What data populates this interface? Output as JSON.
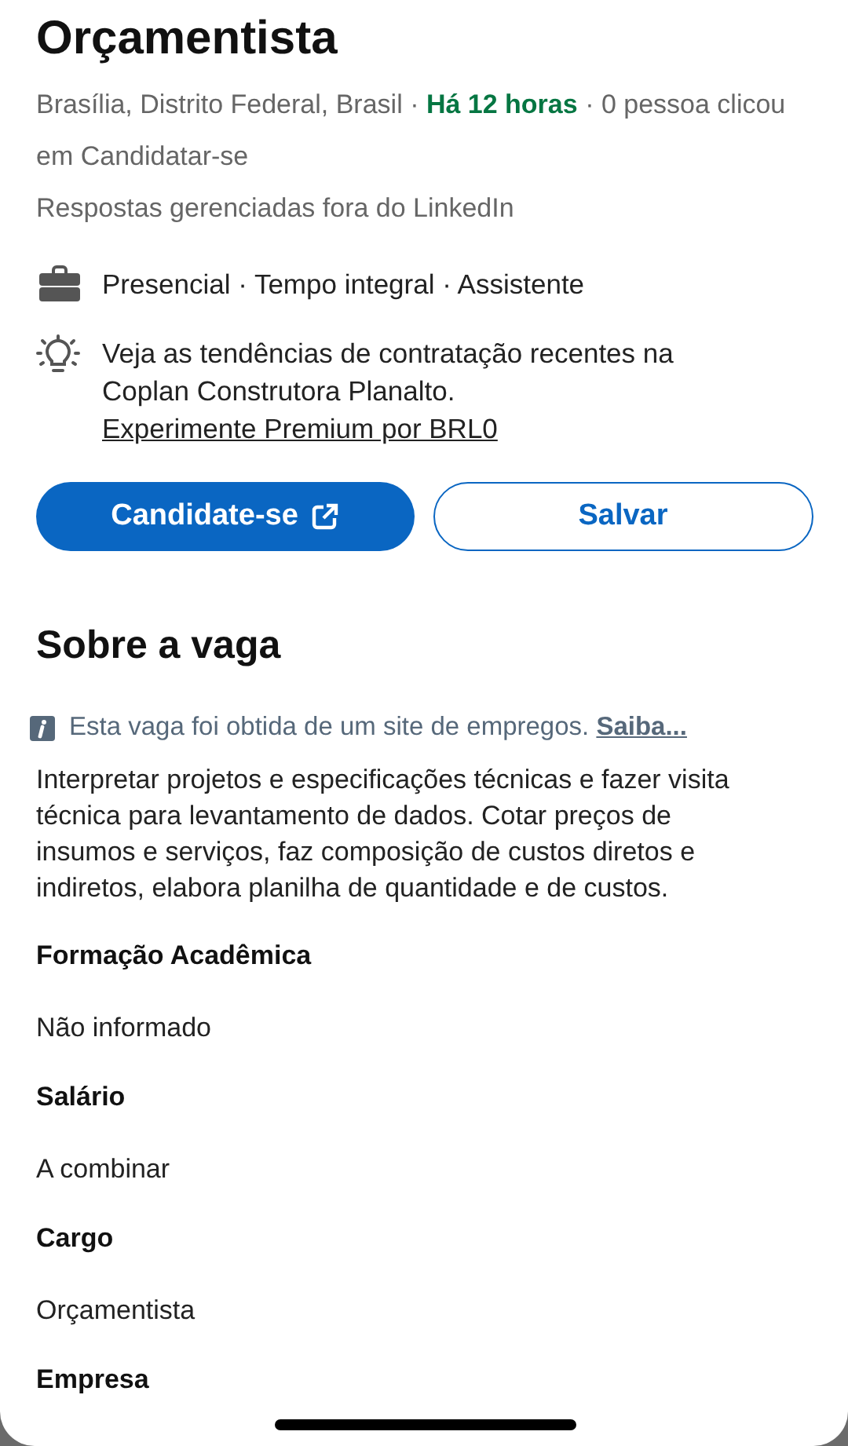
{
  "job": {
    "title": "Orçamentista",
    "meta": "Brasília, Distrito Federal, Brasil · **Há 12 horas** · 0 pessoa clicou em Candidatar-se",
    "responses": "Respostas gerenciadas fora do LinkedIn",
    "workplace": "Presencial · Tempo integral · Assistente",
    "insight": "Veja as tendências de contratação recentes na Coplan Construtora Planalto.",
    "insight_link": "Experimente Premium por BRL0"
  },
  "actions": [
    {
      "kind": "primary",
      "label": "Candidate-se",
      "external": true
    },
    {
      "kind": "secondary",
      "label": "Salvar",
      "external": false
    }
  ],
  "about": {
    "heading": "Sobre a vaga",
    "notice": "Esta vaga foi obtida de um site de empregos.",
    "notice_link": "Saiba...",
    "description": "Interpretar projetos e especificações técnicas e fazer visita técnica para levantamento de dados. Cotar preços de insumos e serviços, faz composição de custos diretos e indiretos, elabora planilha de quantidade e de custos.",
    "fields": [
      {
        "label": "Formação Acadêmica",
        "value": "Não informado"
      },
      {
        "label": "Salário",
        "value": "A combinar"
      },
      {
        "label": "Cargo",
        "value": "Orçamentista"
      },
      {
        "label": "Empresa"
      }
    ]
  }
}
